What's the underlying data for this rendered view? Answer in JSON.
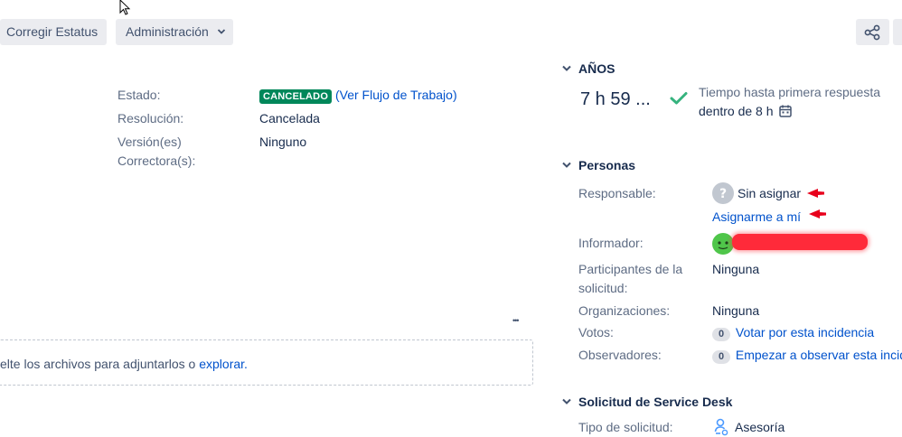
{
  "toolbar": {
    "fix_status_label": "Corregir Estatus",
    "admin_label": "Administración"
  },
  "details": {
    "estado_label": "Estado:",
    "estado_badge": "CANCELADO",
    "workflow_open": "(",
    "workflow_link": "Ver Flujo de Trabajo",
    "workflow_close": ")",
    "resolucion_label": "Resolución:",
    "resolucion_value": "Cancelada",
    "version_label_1": "Versión(es)",
    "version_label_2": "Correctora(s):",
    "version_value": "Ninguno"
  },
  "attachments": {
    "more": "•••",
    "drop_text": "elte los archivos para adjuntarlos o ",
    "browse_link": "explorar."
  },
  "sla": {
    "section_title": "AÑOS",
    "time_value": "7 h 59 ...",
    "description_1": "Tiempo hasta primera respuesta",
    "description_2": "dentro de 8 h",
    "status_color": "#36b37e"
  },
  "people": {
    "section_title": "Personas",
    "assignee_label": "Responsable:",
    "assignee_value": "Sin asignar",
    "assign_me_link": "Asignarme a mí",
    "reporter_label": "Informador:",
    "participants_label_1": "Participantes de la",
    "participants_label_2": "solicitud:",
    "participants_value": "Ninguna",
    "organizations_label": "Organizaciones:",
    "organizations_value": "Ninguna",
    "votes_label": "Votos:",
    "votes_count": "0",
    "vote_link": "Votar por esta incidencia",
    "watchers_label": "Observadores:",
    "watchers_count": "0",
    "watch_link": "Empezar a observar esta incide"
  },
  "service_desk": {
    "section_title": "Solicitud de Service Desk",
    "request_type_label": "Tipo de solicitud:",
    "request_type_value": "Asesoría"
  },
  "icons": [
    "cursor-icon",
    "chevron-down-icon",
    "share-icon",
    "checkmark-icon",
    "calendar-icon",
    "unknown-user-icon",
    "avatar-icon",
    "request-type-icon"
  ]
}
